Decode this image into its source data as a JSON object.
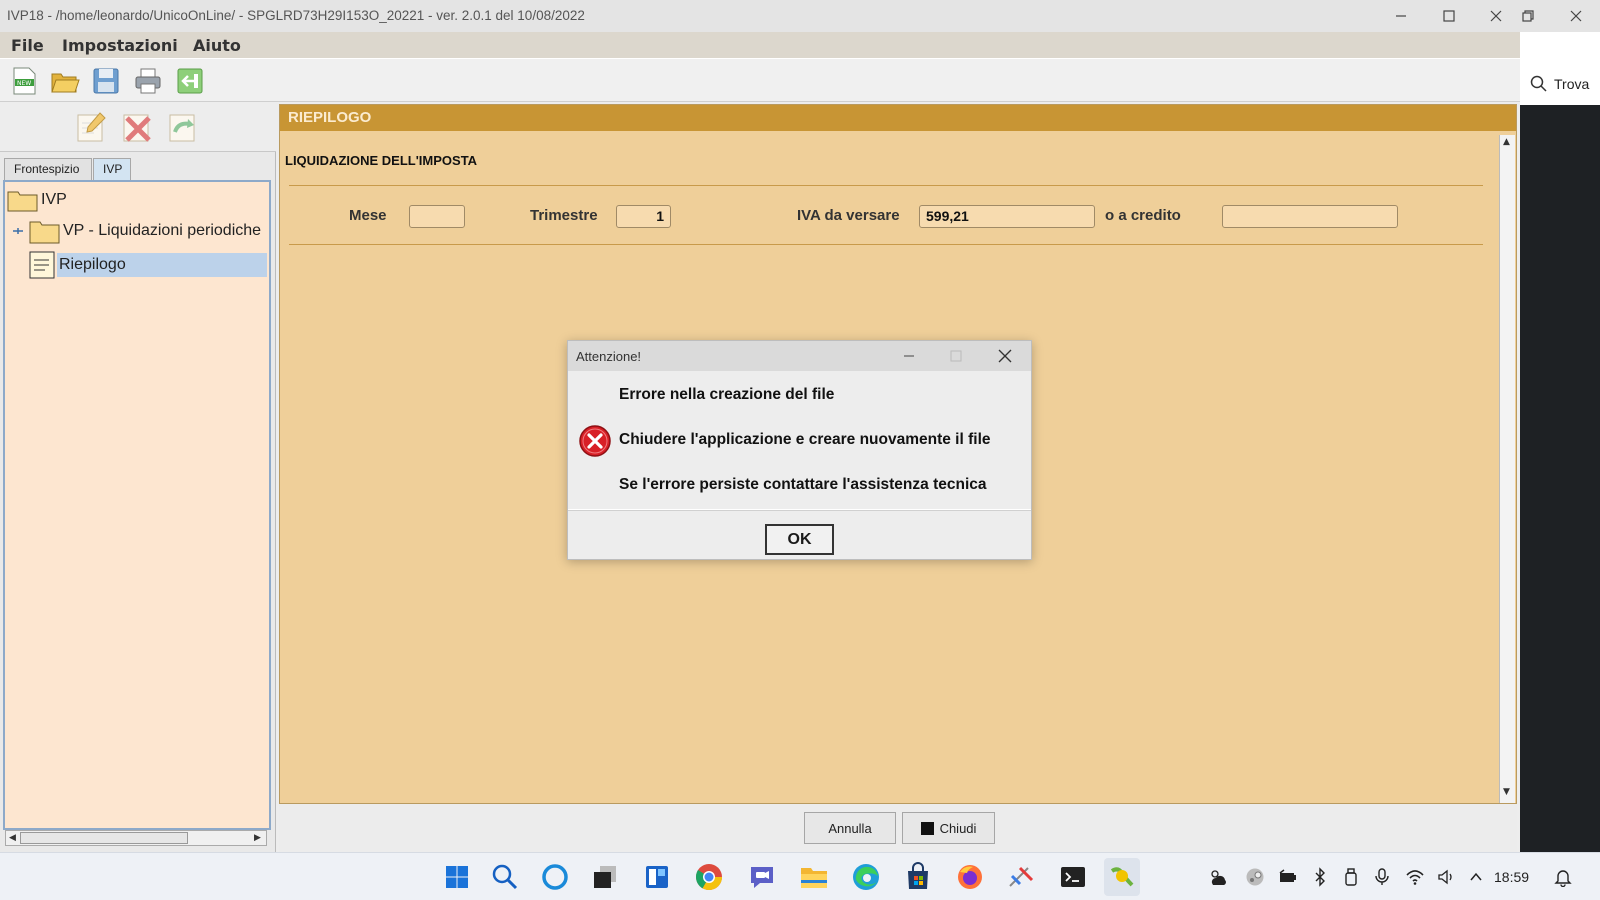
{
  "window": {
    "title": "IVP18 - /home/leonardo/UnicoOnLine/ - SPGLRD73H29I153O_20221 - ver. 2.0.1 del 10/08/2022",
    "controls": [
      "minimize-icon",
      "maximize-icon",
      "close-icon",
      "restore-icon"
    ]
  },
  "menu": {
    "file": "File",
    "impostazioni": "Impostazioni",
    "aiuto": "Aiuto"
  },
  "toolbar": {
    "icons": [
      "new-file-icon",
      "open-folder-icon",
      "save-icon",
      "print-icon",
      "exit-icon"
    ]
  },
  "side_search": {
    "label": "Trova",
    "icon": "search-icon"
  },
  "left_panel": {
    "tools": [
      "edit-icon",
      "delete-icon",
      "refresh-icon"
    ],
    "tabs": [
      {
        "label": "Frontespizio",
        "active": false
      },
      {
        "label": "IVP",
        "active": true
      }
    ],
    "tree": [
      {
        "label": "IVP",
        "icon": "folder-icon"
      },
      {
        "label": "VP - Liquidazioni periodiche",
        "icon": "folder-icon"
      },
      {
        "label": "Riepilogo",
        "icon": "document-icon",
        "selected": true
      }
    ]
  },
  "main": {
    "header": "RIEPILOGO",
    "section_title": "LIQUIDAZIONE DELL'IMPOSTA",
    "fields": {
      "mese_label": "Mese",
      "mese_value": "",
      "trimestre_label": "Trimestre",
      "trimestre_value": "1",
      "iva_label": "IVA da versare",
      "iva_value": "599,21",
      "credito_label": "o a credito",
      "credito_value": ""
    }
  },
  "bottom_buttons": {
    "annulla": "Annulla",
    "chiudi": "Chiudi"
  },
  "dialog": {
    "title": "Attenzione!",
    "line1": "Errore nella creazione del file",
    "line2": "Chiudere l'applicazione e creare nuovamente il file",
    "line3": "Se l'errore persiste contattare l'assistenza tecnica",
    "ok": "OK",
    "icon": "error-icon"
  },
  "colors": {
    "panel_bg": "#efcf99",
    "header_bg": "#c89534",
    "tree_bg": "#fde6d0",
    "tree_selection": "#bcd2ea"
  },
  "taskbar": {
    "apps": [
      "windows-start-icon",
      "search-icon",
      "cortana-icon",
      "task-view-icon",
      "widgets-icon",
      "chrome-icon",
      "teams-chat-icon",
      "file-explorer-icon",
      "edge-icon",
      "store-icon",
      "firefox-icon",
      "app-icon",
      "terminal-icon",
      "ivp-app-icon"
    ],
    "tray": [
      "weather-icon",
      "steam-icon",
      "battery-charging-icon",
      "bluetooth-icon",
      "usb-icon",
      "microphone-icon",
      "wifi-icon",
      "volume-icon",
      "chevron-up-icon"
    ],
    "time": "18:59"
  }
}
